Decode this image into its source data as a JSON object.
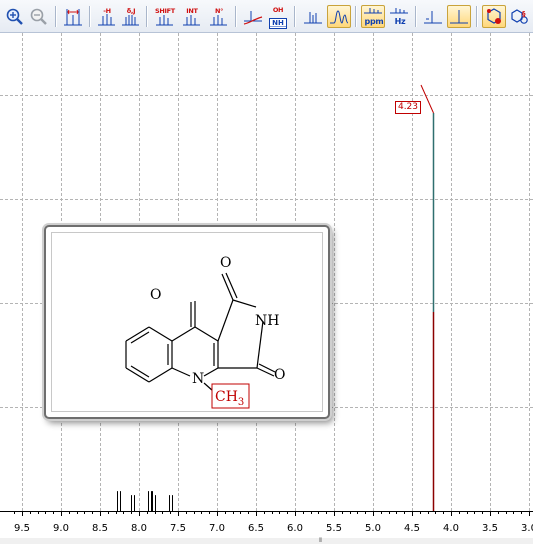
{
  "toolbar": {
    "buttons": [
      {
        "name": "zoom-in-button",
        "icon": "magnifier-plus-icon"
      },
      {
        "name": "zoom-out-button",
        "icon": "magnifier-minus-icon",
        "disabled": true
      },
      {
        "name": "show-width-button",
        "icon": "peak-width-icon"
      },
      {
        "name": "delete-peak-button",
        "icon": "peak-minus-icon",
        "label": "-H"
      },
      {
        "name": "multiplet-button",
        "icon": "multiplet-icon",
        "label": "δ,J"
      },
      {
        "name": "shift-button",
        "icon": "shift-icon",
        "label": "SHIFT"
      },
      {
        "name": "integral-button",
        "icon": "integral-icon",
        "label": "INT"
      },
      {
        "name": "peak-number-button",
        "icon": "peak-number-icon",
        "label": "N°"
      },
      {
        "name": "baseline-button",
        "icon": "baseline-icon"
      },
      {
        "name": "exchangeable-button",
        "icon": "oh-nh-icon",
        "label_top": "OH",
        "label_bottom": "NH"
      },
      {
        "name": "peaks-view-button",
        "icon": "peaks-icon"
      },
      {
        "name": "spectrum-view-button",
        "icon": "spectrum-icon",
        "active": true
      },
      {
        "name": "ppm-units-button",
        "icon": "ppm-icon",
        "label": "ppm",
        "active": true
      },
      {
        "name": "hz-units-button",
        "icon": "hz-icon",
        "label": "Hz"
      },
      {
        "name": "single-line-button",
        "icon": "single-line-icon"
      },
      {
        "name": "line-spectrum-button",
        "icon": "line-spectrum-icon",
        "active": true
      },
      {
        "name": "structure-button",
        "icon": "structure-icon",
        "active": true
      },
      {
        "name": "structure-settings-button",
        "icon": "structure-gear-icon"
      }
    ]
  },
  "spectrum": {
    "peak_label": "4.23",
    "x_axis": {
      "min_ppm": 3.0,
      "max_ppm": 9.6,
      "tick_labels": [
        "9.5",
        "9.0",
        "8.5",
        "8.0",
        "7.5",
        "7.0",
        "6.5",
        "6.0",
        "5.5",
        "5.0",
        "4.5",
        "4.0",
        "3.5",
        "3.0"
      ]
    },
    "colors": {
      "tall_peak_top": "#2f6f6f",
      "tall_peak_bottom": "#8b0000",
      "label_border": "#c00000",
      "grid": "#b4b4b4"
    }
  },
  "chart_data": {
    "type": "line",
    "title": "",
    "xlabel": "",
    "ylabel": "",
    "x_unit": "ppm",
    "xlim": [
      9.6,
      3.0
    ],
    "peaks": [
      {
        "ppm": 4.23,
        "relative_height": 1.0,
        "label": "4.23"
      },
      {
        "ppm": 8.28,
        "relative_height": 0.05
      },
      {
        "ppm": 8.24,
        "relative_height": 0.05
      },
      {
        "ppm": 8.1,
        "relative_height": 0.04
      },
      {
        "ppm": 8.06,
        "relative_height": 0.04
      },
      {
        "ppm": 7.88,
        "relative_height": 0.05
      },
      {
        "ppm": 7.85,
        "relative_height": 0.05
      },
      {
        "ppm": 7.83,
        "relative_height": 0.05
      },
      {
        "ppm": 7.8,
        "relative_height": 0.04
      },
      {
        "ppm": 7.61,
        "relative_height": 0.04
      },
      {
        "ppm": 7.58,
        "relative_height": 0.04
      }
    ],
    "grid": true
  },
  "structure": {
    "atoms": {
      "o_top": "O",
      "nh": "NH",
      "o_left": "O",
      "o_right": "O",
      "n": "N",
      "methyl_main": "CH",
      "methyl_sub": "3"
    },
    "methyl_label_color": "#c00000"
  },
  "scrollbar": {
    "grip": "⦀"
  }
}
